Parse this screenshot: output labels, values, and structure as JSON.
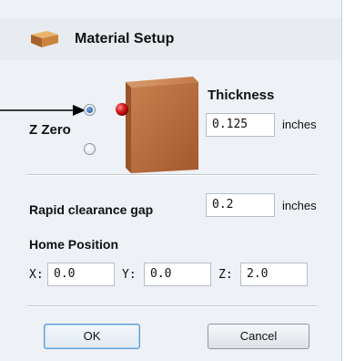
{
  "header": {
    "title": "Material Setup",
    "icon": "material-block-icon"
  },
  "zero": {
    "label": "Z Zero",
    "selected": "top"
  },
  "thickness": {
    "label": "Thickness",
    "value": "0.125",
    "unit": "inches"
  },
  "rapid": {
    "label": "Rapid clearance gap",
    "value": "0.2",
    "unit": "inches"
  },
  "home": {
    "label": "Home Position",
    "x_label": "X:",
    "x_value": "0.0",
    "y_label": "Y:",
    "y_value": "0.0",
    "z_label": "Z:",
    "z_value": "2.0"
  },
  "buttons": {
    "ok": "OK",
    "cancel": "Cancel"
  },
  "colors": {
    "panel": "#eef1f5",
    "block": "#b8703e",
    "marker": "#cc1a1a",
    "default_button_border": "#5b9bd5"
  }
}
